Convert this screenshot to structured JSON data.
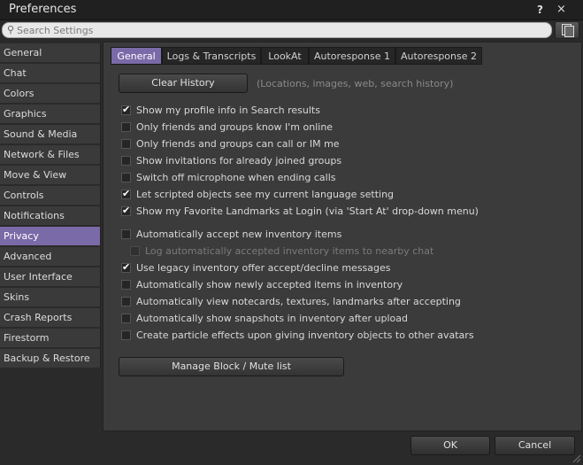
{
  "window": {
    "title": "Preferences",
    "help": "?",
    "close": "×"
  },
  "search": {
    "placeholder": "Search Settings"
  },
  "sidebar": {
    "items": [
      {
        "label": "General"
      },
      {
        "label": "Chat"
      },
      {
        "label": "Colors"
      },
      {
        "label": "Graphics"
      },
      {
        "label": "Sound & Media"
      },
      {
        "label": "Network & Files"
      },
      {
        "label": "Move & View"
      },
      {
        "label": "Controls"
      },
      {
        "label": "Notifications"
      },
      {
        "label": "Privacy"
      },
      {
        "label": "Advanced"
      },
      {
        "label": "User Interface"
      },
      {
        "label": "Skins"
      },
      {
        "label": "Crash Reports"
      },
      {
        "label": "Firestorm"
      },
      {
        "label": "Backup & Restore"
      }
    ],
    "selected": "Privacy"
  },
  "tabs": [
    {
      "label": "General"
    },
    {
      "label": "Logs & Transcripts"
    },
    {
      "label": "LookAt"
    },
    {
      "label": "Autoresponse 1"
    },
    {
      "label": "Autoresponse 2"
    }
  ],
  "active_tab": "General",
  "main": {
    "clear_history_label": "Clear History",
    "clear_history_hint": "(Locations, images, web, search history)",
    "options": [
      {
        "label": "Show my profile info in Search results",
        "checked": true,
        "enabled": true
      },
      {
        "label": "Only friends and groups know I'm online",
        "checked": false,
        "enabled": true
      },
      {
        "label": "Only friends and groups can call or IM me",
        "checked": false,
        "enabled": true
      },
      {
        "label": "Show invitations for already joined groups",
        "checked": false,
        "enabled": true
      },
      {
        "label": "Switch off microphone when ending calls",
        "checked": false,
        "enabled": true
      },
      {
        "label": "Let scripted objects see my current language setting",
        "checked": true,
        "enabled": true
      },
      {
        "label": "Show my Favorite Landmarks at Login (via 'Start At' drop-down menu)",
        "checked": true,
        "enabled": true
      },
      {
        "label": "Automatically accept new inventory items",
        "checked": false,
        "enabled": true
      },
      {
        "label": "Log automatically accepted inventory items to nearby chat",
        "checked": false,
        "enabled": false
      },
      {
        "label": "Use legacy inventory offer accept/decline messages",
        "checked": true,
        "enabled": true
      },
      {
        "label": "Automatically show newly accepted items in inventory",
        "checked": false,
        "enabled": true
      },
      {
        "label": "Automatically view notecards, textures, landmarks after accepting",
        "checked": false,
        "enabled": true
      },
      {
        "label": "Automatically show snapshots in inventory after upload",
        "checked": false,
        "enabled": true
      },
      {
        "label": "Create particle effects upon giving inventory objects to other avatars",
        "checked": false,
        "enabled": true
      }
    ],
    "manage_block_label": "Manage Block / Mute list"
  },
  "footer": {
    "ok_label": "OK",
    "cancel_label": "Cancel"
  },
  "colors": {
    "accent": "#7b6aa8",
    "background": "#2a2a2a",
    "panel": "#3b3b3b"
  }
}
